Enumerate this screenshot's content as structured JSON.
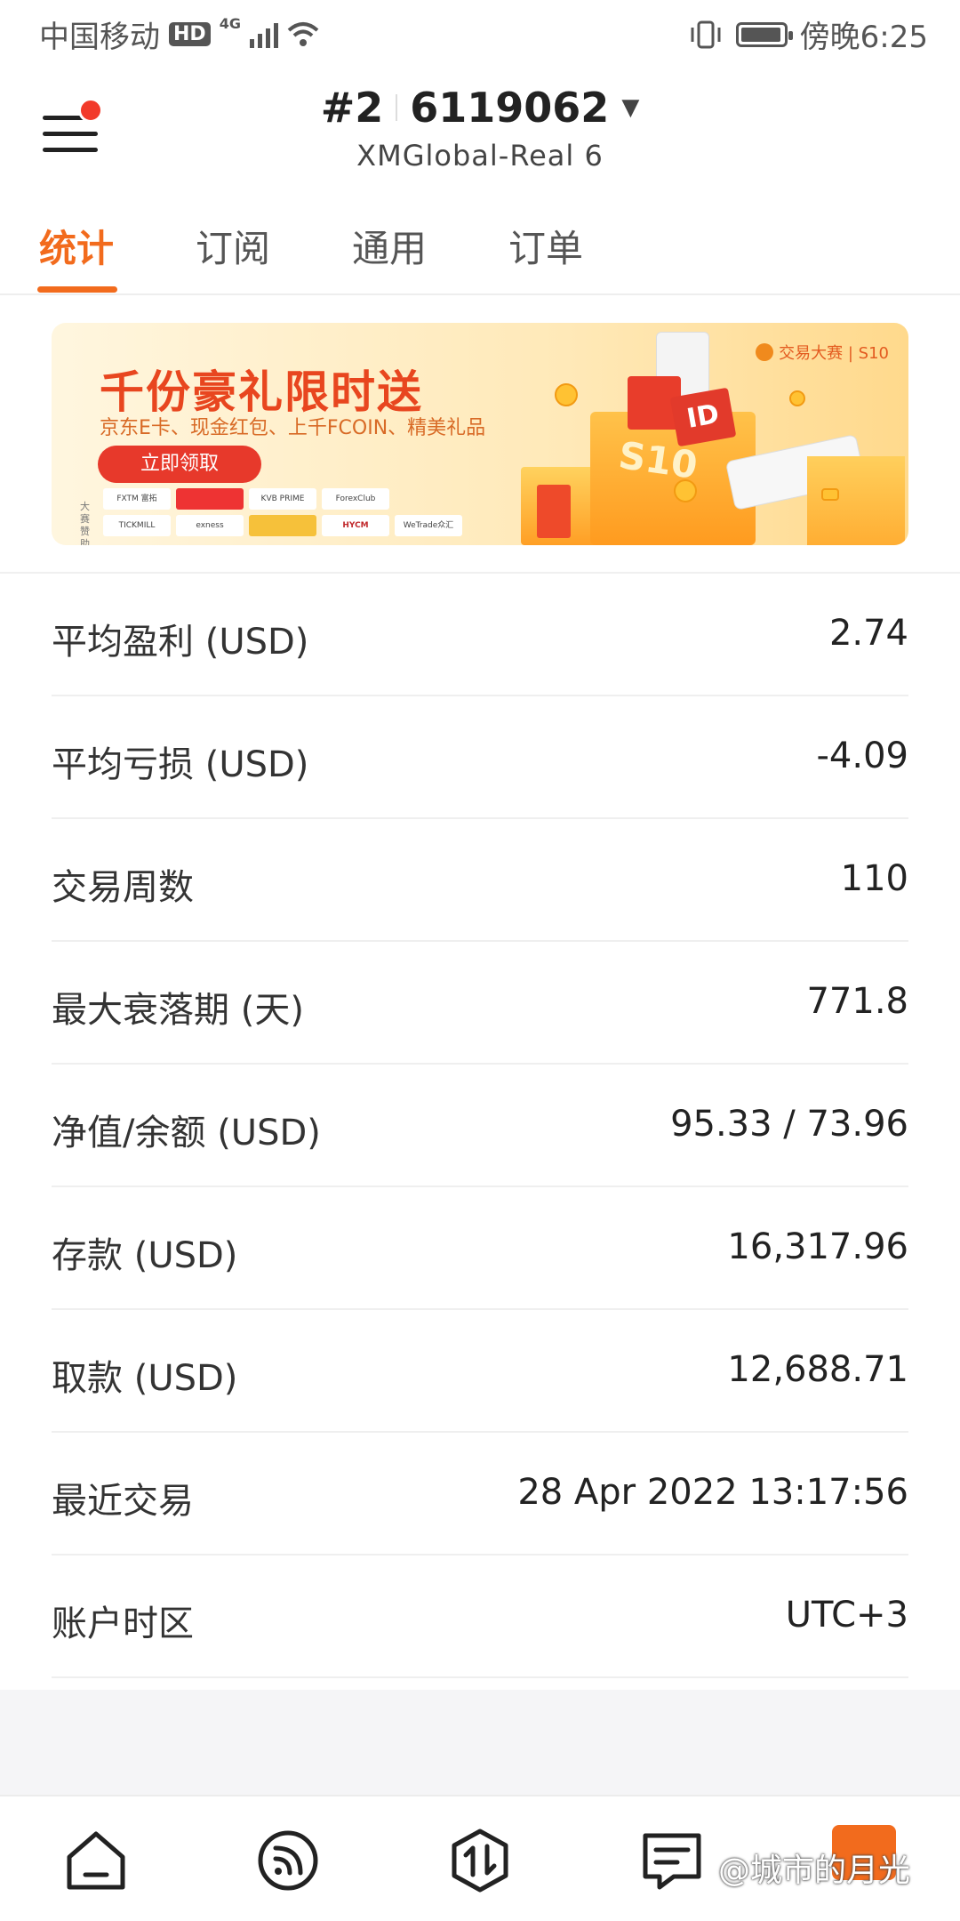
{
  "status_bar": {
    "carrier": "中国移动",
    "hd": "HD",
    "network": "4G",
    "time": "傍晚6:25"
  },
  "header": {
    "account_rank": "#2",
    "account_number": "6119062",
    "server": "XMGlobal-Real 6"
  },
  "tabs": [
    {
      "label": "统计",
      "active": true
    },
    {
      "label": "订阅",
      "active": false
    },
    {
      "label": "通用",
      "active": false
    },
    {
      "label": "订单",
      "active": false
    }
  ],
  "banner": {
    "title": "千份豪礼限时送",
    "subtitle": "京东E卡、现金红包、上千FCOIN、精美礼品",
    "button": "立即领取",
    "sponsor_label": "大赛赞助",
    "brand": "交易大赛 | S10",
    "box_label": "S10",
    "card_label": "ID",
    "sponsors": [
      "FXTM 富拓",
      "",
      "KVB PRIME",
      "ForexClub",
      "",
      "TICKMILL",
      "exness",
      "",
      "HYCM",
      "WeTrade众汇"
    ]
  },
  "stats": [
    {
      "label": "平均盈利 (USD)",
      "value": "2.74"
    },
    {
      "label": "平均亏损 (USD)",
      "value": "-4.09"
    },
    {
      "label": "交易周数",
      "value": "110"
    },
    {
      "label": "最大衰落期 (天)",
      "value": "771.8"
    },
    {
      "label": "净值/余额 (USD)",
      "value": "95.33 / 73.96"
    },
    {
      "label": "存款 (USD)",
      "value": "16,317.96"
    },
    {
      "label": "取款 (USD)",
      "value": "12,688.71"
    },
    {
      "label": "最近交易",
      "value": "28 Apr 2022 13:17:56"
    },
    {
      "label": "账户时区",
      "value": "UTC+3"
    }
  ],
  "bottom_nav": {
    "items": [
      "home-icon",
      "feed-icon",
      "trade-icon",
      "document-icon"
    ],
    "watermark": "@城市的月光"
  },
  "colors": {
    "accent": "#f26b1d",
    "notification_dot": "#f23a2a"
  }
}
